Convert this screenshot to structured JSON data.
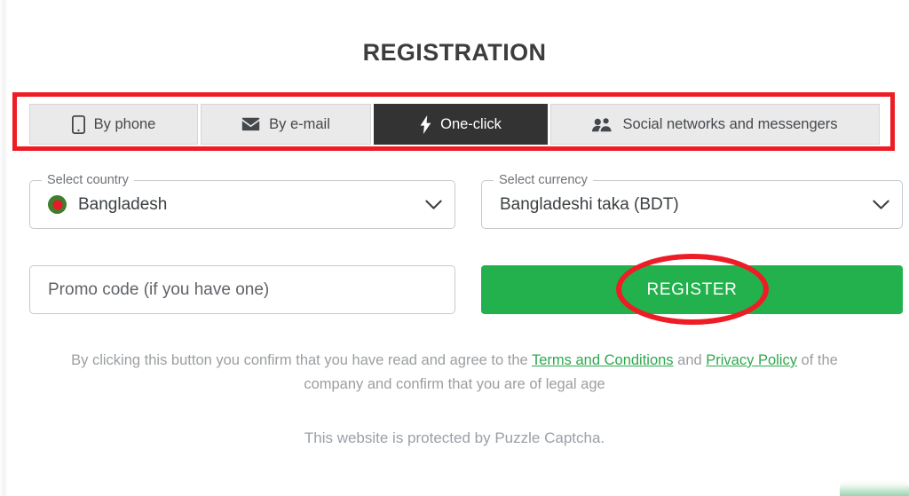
{
  "header": {
    "title": "REGISTRATION"
  },
  "tabs": [
    {
      "id": "by-phone",
      "label": "By phone",
      "icon": "phone-icon",
      "active": false
    },
    {
      "id": "by-email",
      "label": "By e-mail",
      "icon": "envelope-icon",
      "active": false
    },
    {
      "id": "one-click",
      "label": "One-click",
      "icon": "lightning-bolt-icon",
      "active": true
    },
    {
      "id": "social-networks",
      "label": "Social networks and messengers",
      "icon": "people-icon",
      "active": false
    }
  ],
  "form": {
    "country": {
      "legend": "Select country",
      "value": "Bangladesh",
      "flag": "bangladesh-flag-icon",
      "chevron": "chevron-down-icon"
    },
    "currency": {
      "legend": "Select currency",
      "value": "Bangladeshi taka (BDT)",
      "chevron": "chevron-down-icon"
    },
    "promo": {
      "placeholder": "Promo code (if you have one)",
      "value": ""
    },
    "submit": {
      "label": "REGISTER"
    }
  },
  "legal": {
    "intro": "By clicking this button you confirm that you have read and agree to the ",
    "terms_link": "Terms and Conditions",
    "conjunction": " and ",
    "privacy_link": "Privacy Policy",
    "outro": " of the company and confirm that you are of legal age"
  },
  "captcha": {
    "note": "This website is protected by Puzzle Captcha."
  },
  "colors": {
    "accent_green": "#22b14c",
    "link_green": "#2fa84f",
    "annotation_red": "#ee1c25",
    "active_tab_bg": "#333333",
    "tab_bg": "#eaeaea",
    "title_color": "#3d3d3d"
  }
}
